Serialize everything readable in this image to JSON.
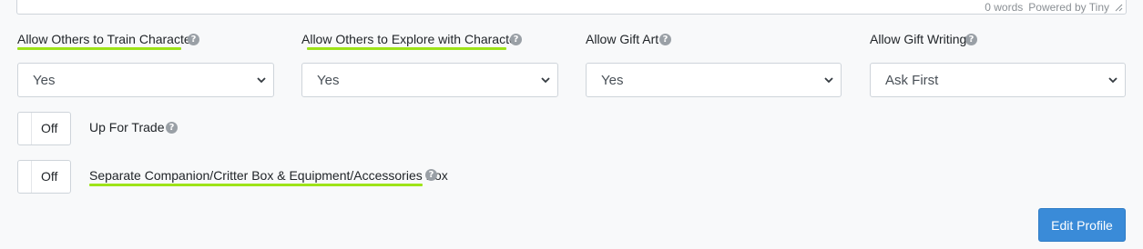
{
  "editor": {
    "word_count": "0 words",
    "powered_by": "Powered by Tiny"
  },
  "fields": {
    "train": {
      "label": "Allow Others to Train Character",
      "value": "Yes"
    },
    "explore": {
      "label": "Allow Others to Explore with Character",
      "value": "Yes"
    },
    "gift_art": {
      "label": "Allow Gift Art",
      "value": "Yes"
    },
    "gift_writing": {
      "label": "Allow Gift Writing",
      "value": "Ask First"
    }
  },
  "toggles": {
    "trade": {
      "state": "Off",
      "label": "Up For Trade"
    },
    "separate_box": {
      "state": "Off",
      "label": "Separate Companion/Critter Box & Equipment/Accessories Box"
    }
  },
  "help_glyph": "?",
  "actions": {
    "edit_profile": "Edit Profile"
  },
  "colors": {
    "highlight_underline": "#9ee318",
    "primary_button": "#3a8bd8",
    "background": "#f8f9fa"
  },
  "icons": [
    "help-icon",
    "chevron-down-icon",
    "resize-grip-icon"
  ]
}
